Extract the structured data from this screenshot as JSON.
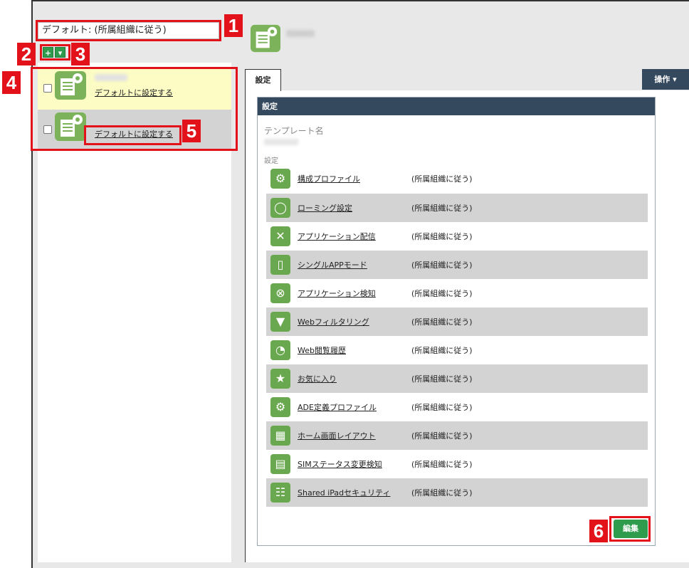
{
  "header": {
    "default_select": "デフォルト: (所属組織に従う)"
  },
  "toolbar": {
    "add_label": "+",
    "dropdown_label": "▾"
  },
  "templates": [
    {
      "set_default": "デフォルトに設定する"
    },
    {
      "set_default": "デフォルトに設定する"
    }
  ],
  "tabs": {
    "settings": "設定",
    "operations": "操作 ▾"
  },
  "panel": {
    "title": "設定",
    "template_name_label": "テンプレート名",
    "settings_label": "設定",
    "rows": [
      {
        "label": "構成プロファイル",
        "value": "(所属組織に従う)",
        "icon": "gear-icon"
      },
      {
        "label": "ローミング設定",
        "value": "(所属組織に従う)",
        "icon": "globe-icon"
      },
      {
        "label": "アプリケーション配信",
        "value": "(所属組織に従う)",
        "icon": "tools-icon"
      },
      {
        "label": "シングルAPPモード",
        "value": "(所属組織に従う)",
        "icon": "lock-device-icon"
      },
      {
        "label": "アプリケーション検知",
        "value": "(所属組織に従う)",
        "icon": "search-icon"
      },
      {
        "label": "Webフィルタリング",
        "value": "(所属組織に従う)",
        "icon": "filter-icon"
      },
      {
        "label": "Web閲覧履歴",
        "value": "(所属組織に従う)",
        "icon": "history-icon"
      },
      {
        "label": "お気に入り",
        "value": "(所属組織に従う)",
        "icon": "star-icon"
      },
      {
        "label": "ADE定義プロファイル",
        "value": "(所属組織に従う)",
        "icon": "gear-icon"
      },
      {
        "label": "ホーム画面レイアウト",
        "value": "(所属組織に従う)",
        "icon": "grid-icon"
      },
      {
        "label": "SIMステータス変更検知",
        "value": "(所属組織に従う)",
        "icon": "sim-icon"
      },
      {
        "label": "Shared iPadセキュリティ",
        "value": "(所属組織に従う)",
        "icon": "users-icon"
      }
    ],
    "edit_button": "編集"
  },
  "annotations": [
    "1",
    "2",
    "3",
    "4",
    "5",
    "6"
  ],
  "colors": {
    "accent_red": "#e3111a",
    "header_navy": "#34495e",
    "button_green": "#2e9c4c",
    "selected_yellow": "#fdfcc4"
  }
}
